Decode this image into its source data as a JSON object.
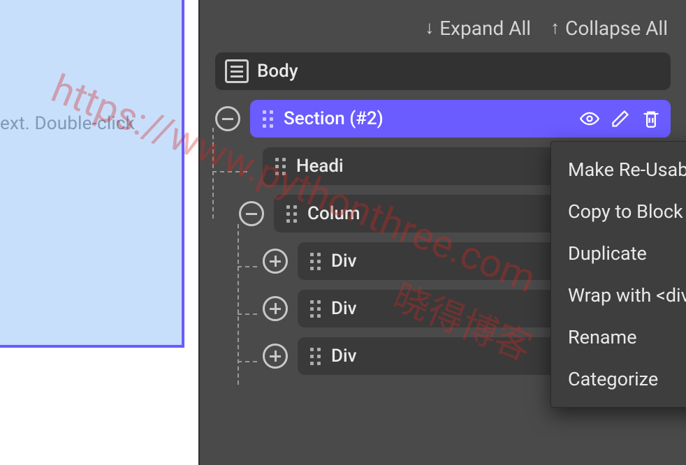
{
  "canvas": {
    "placeholder_text": "ext. Double-click"
  },
  "toolbar": {
    "expand_label": "Expand All",
    "collapse_label": "Collapse All"
  },
  "tree": {
    "root_label": "Body",
    "section_label": "Section (#2)",
    "heading_label": "Headi",
    "columns_label": "Colum",
    "div1_label": "Div",
    "div2_label": "Div",
    "div3_label": "Div"
  },
  "context_menu": {
    "items": [
      "Make Re-Usable",
      "Copy to Block",
      "Duplicate",
      "Wrap with <div>",
      "Rename",
      "Categorize"
    ]
  },
  "watermark": {
    "line1": "https://www.pythonthree.com",
    "line2": "晓得博客"
  }
}
